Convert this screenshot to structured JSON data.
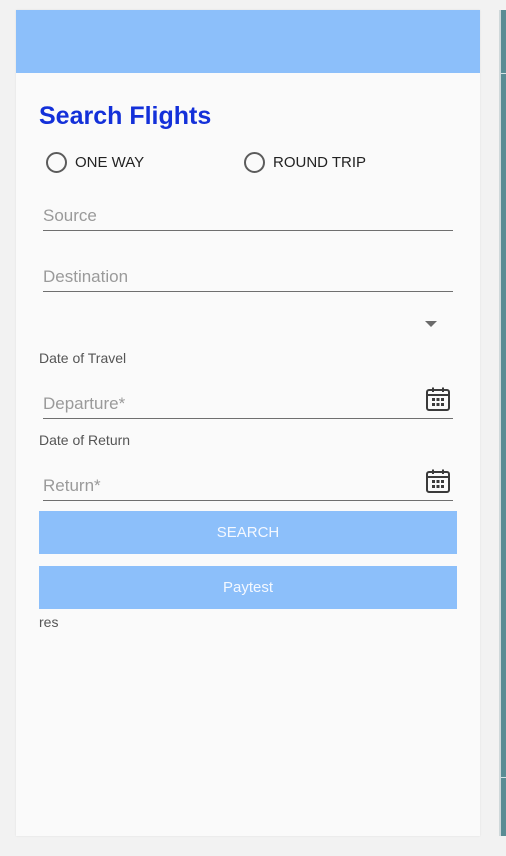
{
  "colors": {
    "header": "#8cbffa",
    "title": "#1330d9",
    "button": "#8cbffa"
  },
  "form": {
    "title": "Search Flights",
    "trip_type": {
      "one_way": "ONE WAY",
      "round_trip": "ROUND TRIP"
    },
    "source_placeholder": "Source",
    "destination_placeholder": "Destination",
    "date_of_travel_label": "Date of Travel",
    "departure_placeholder": "Departure*",
    "date_of_return_label": "Date of Return",
    "return_placeholder": "Return*",
    "search_button": "SEARCH",
    "paytest_button": "Paytest",
    "result_text": "res"
  },
  "icons": {
    "calendar": "calendar-icon",
    "dropdown": "chevron-down-icon"
  }
}
